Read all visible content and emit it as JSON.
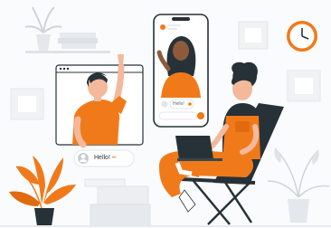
{
  "illustration": {
    "greeting_label": "Hello!",
    "greeting_emoji": "••",
    "phone_chat_text": "Hello!",
    "accent_color": "#f07a1a",
    "background_color": "#ffffff",
    "ink_color": "#263238",
    "icons": [
      "clock-icon",
      "laptop-icon",
      "phone-icon",
      "plant-icon",
      "avatar-icon"
    ]
  }
}
